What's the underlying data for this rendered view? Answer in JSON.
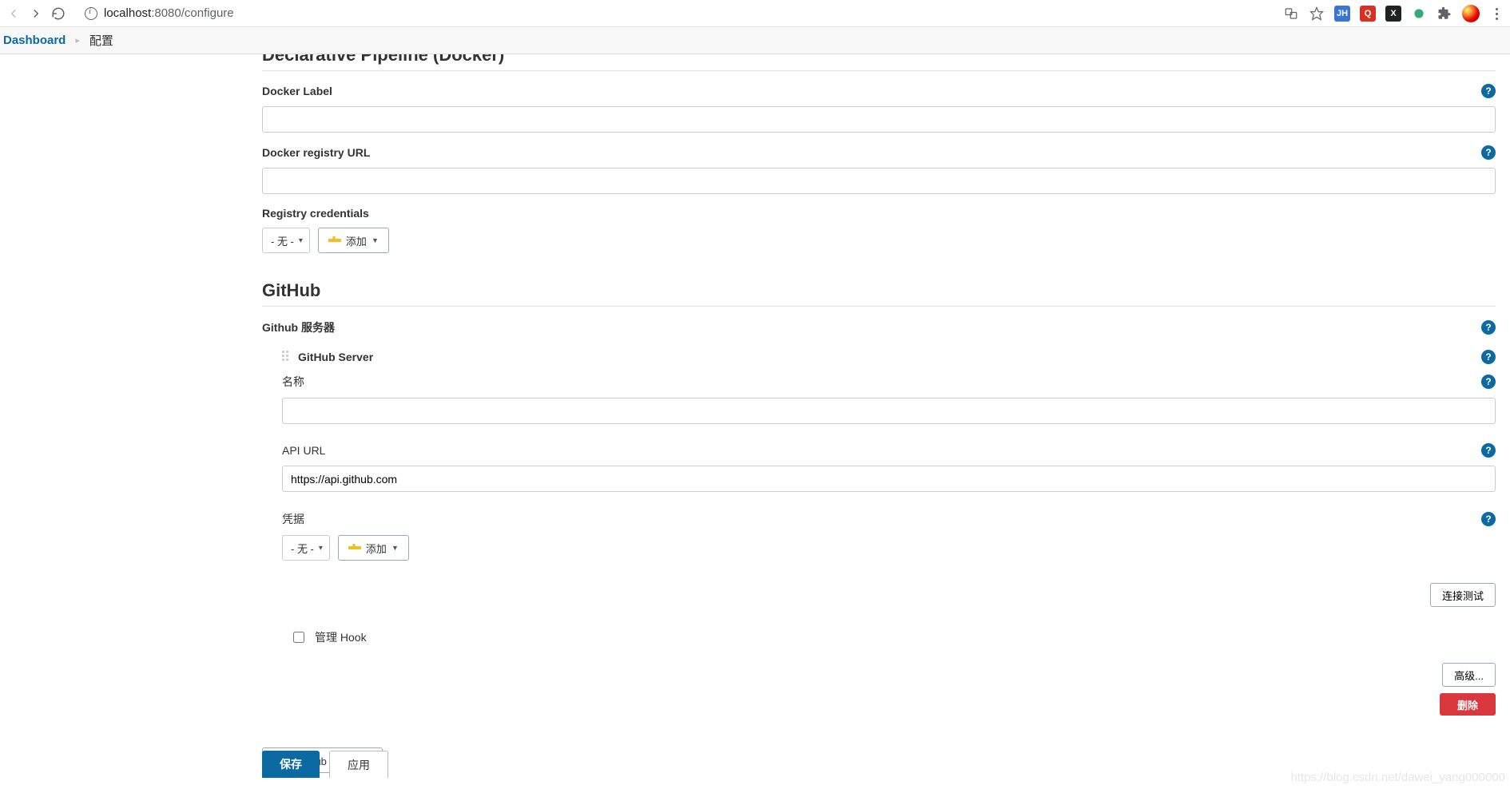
{
  "browser": {
    "url_host": "localhost",
    "url_port": ":8080",
    "url_path": "/configure"
  },
  "breadcrumb": {
    "dashboard": "Dashboard",
    "page": "配置"
  },
  "docker": {
    "title": "Declarative Pipeline (Docker)",
    "label1": "Docker Label",
    "value1": "",
    "label2": "Docker registry URL",
    "value2": "",
    "label3": "Registry credentials",
    "select_none": "- 无 -",
    "add_btn": "添加"
  },
  "github": {
    "title": "GitHub",
    "label_servers": "Github 服务器",
    "server_title": "GitHub Server",
    "name_label": "名称",
    "name_value": "",
    "apiurl_label": "API URL",
    "apiurl_value": "https://api.github.com",
    "creds_label": "凭据",
    "select_none": "- 无 -",
    "add_btn": "添加",
    "test_btn": "连接测试",
    "hook_label": "管理 Hook",
    "adv_btn": "高级...",
    "delete_btn": "删除",
    "add_server_btn": "添加 Github 服务器"
  },
  "footer": {
    "save": "保存",
    "apply": "应用"
  },
  "watermark": "https://blog.csdn.net/dawei_yang000000"
}
